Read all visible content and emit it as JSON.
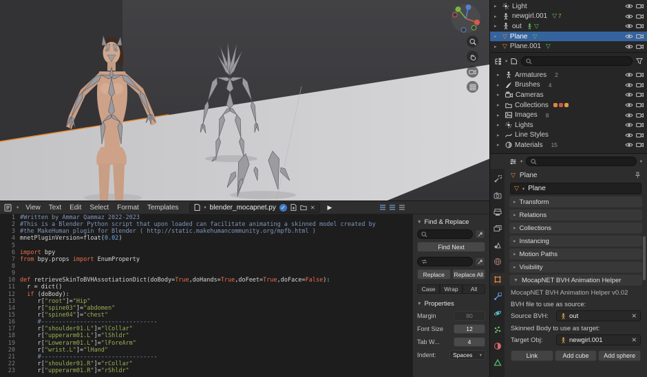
{
  "viewport": {
    "tools": [
      {
        "icon": "zoom"
      },
      {
        "icon": "move"
      },
      {
        "icon": "camera"
      },
      {
        "icon": "grid"
      }
    ]
  },
  "outliner": {
    "rows": [
      {
        "label": "Light",
        "icon": "light",
        "trail": [],
        "badge": "",
        "selected": false
      },
      {
        "label": "newgirl.001",
        "icon": "armature",
        "trail": [
          "mesh-data"
        ],
        "badge": "7",
        "selected": false
      },
      {
        "label": "out",
        "icon": "armature",
        "trail": [
          "armature-data",
          "mesh-data"
        ],
        "badge": "",
        "selected": false
      },
      {
        "label": "Plane",
        "icon": "mesh-object",
        "trail": [
          "mesh-data"
        ],
        "badge": "",
        "selected": true
      },
      {
        "label": "Plane.001",
        "icon": "mesh-object",
        "trail": [
          "mesh-data"
        ],
        "badge": "",
        "selected": false
      }
    ]
  },
  "data_browser": {
    "search_placeholder": "",
    "categories": [
      {
        "label": "Armatures",
        "icon": "armature",
        "count": "2",
        "trail": []
      },
      {
        "label": "Brushes",
        "icon": "brush",
        "count": "4",
        "trail": []
      },
      {
        "label": "Cameras",
        "icon": "camera",
        "count": "",
        "trail": []
      },
      {
        "label": "Collections",
        "icon": "collection",
        "count": "",
        "trail": [
          "dot-orange",
          "dot-red",
          "dot-gold"
        ]
      },
      {
        "label": "Images",
        "icon": "image",
        "count": "8",
        "trail": []
      },
      {
        "label": "Lights",
        "icon": "light",
        "count": "",
        "trail": []
      },
      {
        "label": "Line Styles",
        "icon": "linestyle",
        "count": "",
        "trail": []
      },
      {
        "label": "Materials",
        "icon": "material",
        "count": "15",
        "trail": []
      }
    ]
  },
  "properties": {
    "search_placeholder": "",
    "breadcrumb": "Plane",
    "object_name": "Plane",
    "tabs": [
      {
        "icon": "tool",
        "active": false
      },
      {
        "icon": "render",
        "active": false
      },
      {
        "icon": "output",
        "active": false
      },
      {
        "icon": "view-layer",
        "active": false
      },
      {
        "icon": "scene",
        "active": false
      },
      {
        "icon": "world",
        "active": false
      },
      {
        "icon": "object",
        "active": true
      },
      {
        "icon": "modifiers",
        "active": false
      },
      {
        "icon": "physics",
        "active": false
      },
      {
        "icon": "particles",
        "active": false
      },
      {
        "icon": "material",
        "active": false
      },
      {
        "icon": "data",
        "active": false
      }
    ],
    "panels": [
      "Transform",
      "Relations",
      "Collections",
      "Instancing",
      "Motion Paths",
      "Visibility"
    ],
    "mocapnet": {
      "panel_title": "MocapNET BVH Animation Helper",
      "version_line": "MocapNET BVH Animation Helper v0.02",
      "source_section_label": "BVH file to use as source:",
      "source_field_label": "Source BVH:",
      "source_value": "out",
      "target_section_label": "Skinned Body to use as target:",
      "target_field_label": "Target Obj:",
      "target_value": "newgirl.001",
      "buttons": [
        "Link",
        "Add cube",
        "Add sphere"
      ]
    }
  },
  "text_editor": {
    "menus": [
      "View",
      "Text",
      "Edit",
      "Select",
      "Format",
      "Templates"
    ],
    "filename": "blender_mocapnet.py",
    "sidebar": {
      "find_title": "Find & Replace",
      "find_next_label": "Find Next",
      "replace_label": "Replace",
      "replace_all_label": "Replace All",
      "toggles": [
        "Case",
        "Wrap",
        "All"
      ],
      "properties_title": "Properties",
      "fields": [
        {
          "label": "Margin",
          "value": "80",
          "kind": "dim"
        },
        {
          "label": "Font Size",
          "value": "12",
          "kind": "num"
        },
        {
          "label": "Tab W...",
          "value": "4",
          "kind": "num"
        },
        {
          "label": "Indent:",
          "value": "Spaces",
          "kind": "menu"
        }
      ]
    },
    "code": [
      "#Written by Ammar Qammaz 2022-2023",
      "#This is a Blender Python script that upon loaded can facilitate animating a skinned model created by",
      "#the MakeHuman plugin for Blender ( http://static.makehumancommunity.org/mpfb.html )",
      "mnetPluginVersion=float(0.02)",
      "",
      "import bpy",
      "from bpy.props import EnumProperty",
      "",
      "",
      "def retrieveSkinToBVHAssotiationDict(doBody=True,doHands=True,doFeet=True,doFace=False):",
      "  r = dict()",
      "  if (doBody):",
      "     r[\"root\"]=\"Hip\"",
      "     r[\"spine03\"]=\"abdomen\"",
      "     r[\"spine04\"]=\"chest\"",
      "     #---------------------------------",
      "     r[\"shoulder01.L\"]=\"lCollar\"",
      "     r[\"upperarm01.L\"]=\"lShldr\"",
      "     r[\"Lowerarm01.L\"]=\"lForeArm\"",
      "     r[\"wrist.L\"]=\"lHand\"",
      "     #---------------------------------",
      "     r[\"shoulder01.R\"]=\"rCollar\"",
      "     r[\"upperarm01.R\"]=\"rShldr\""
    ]
  }
}
